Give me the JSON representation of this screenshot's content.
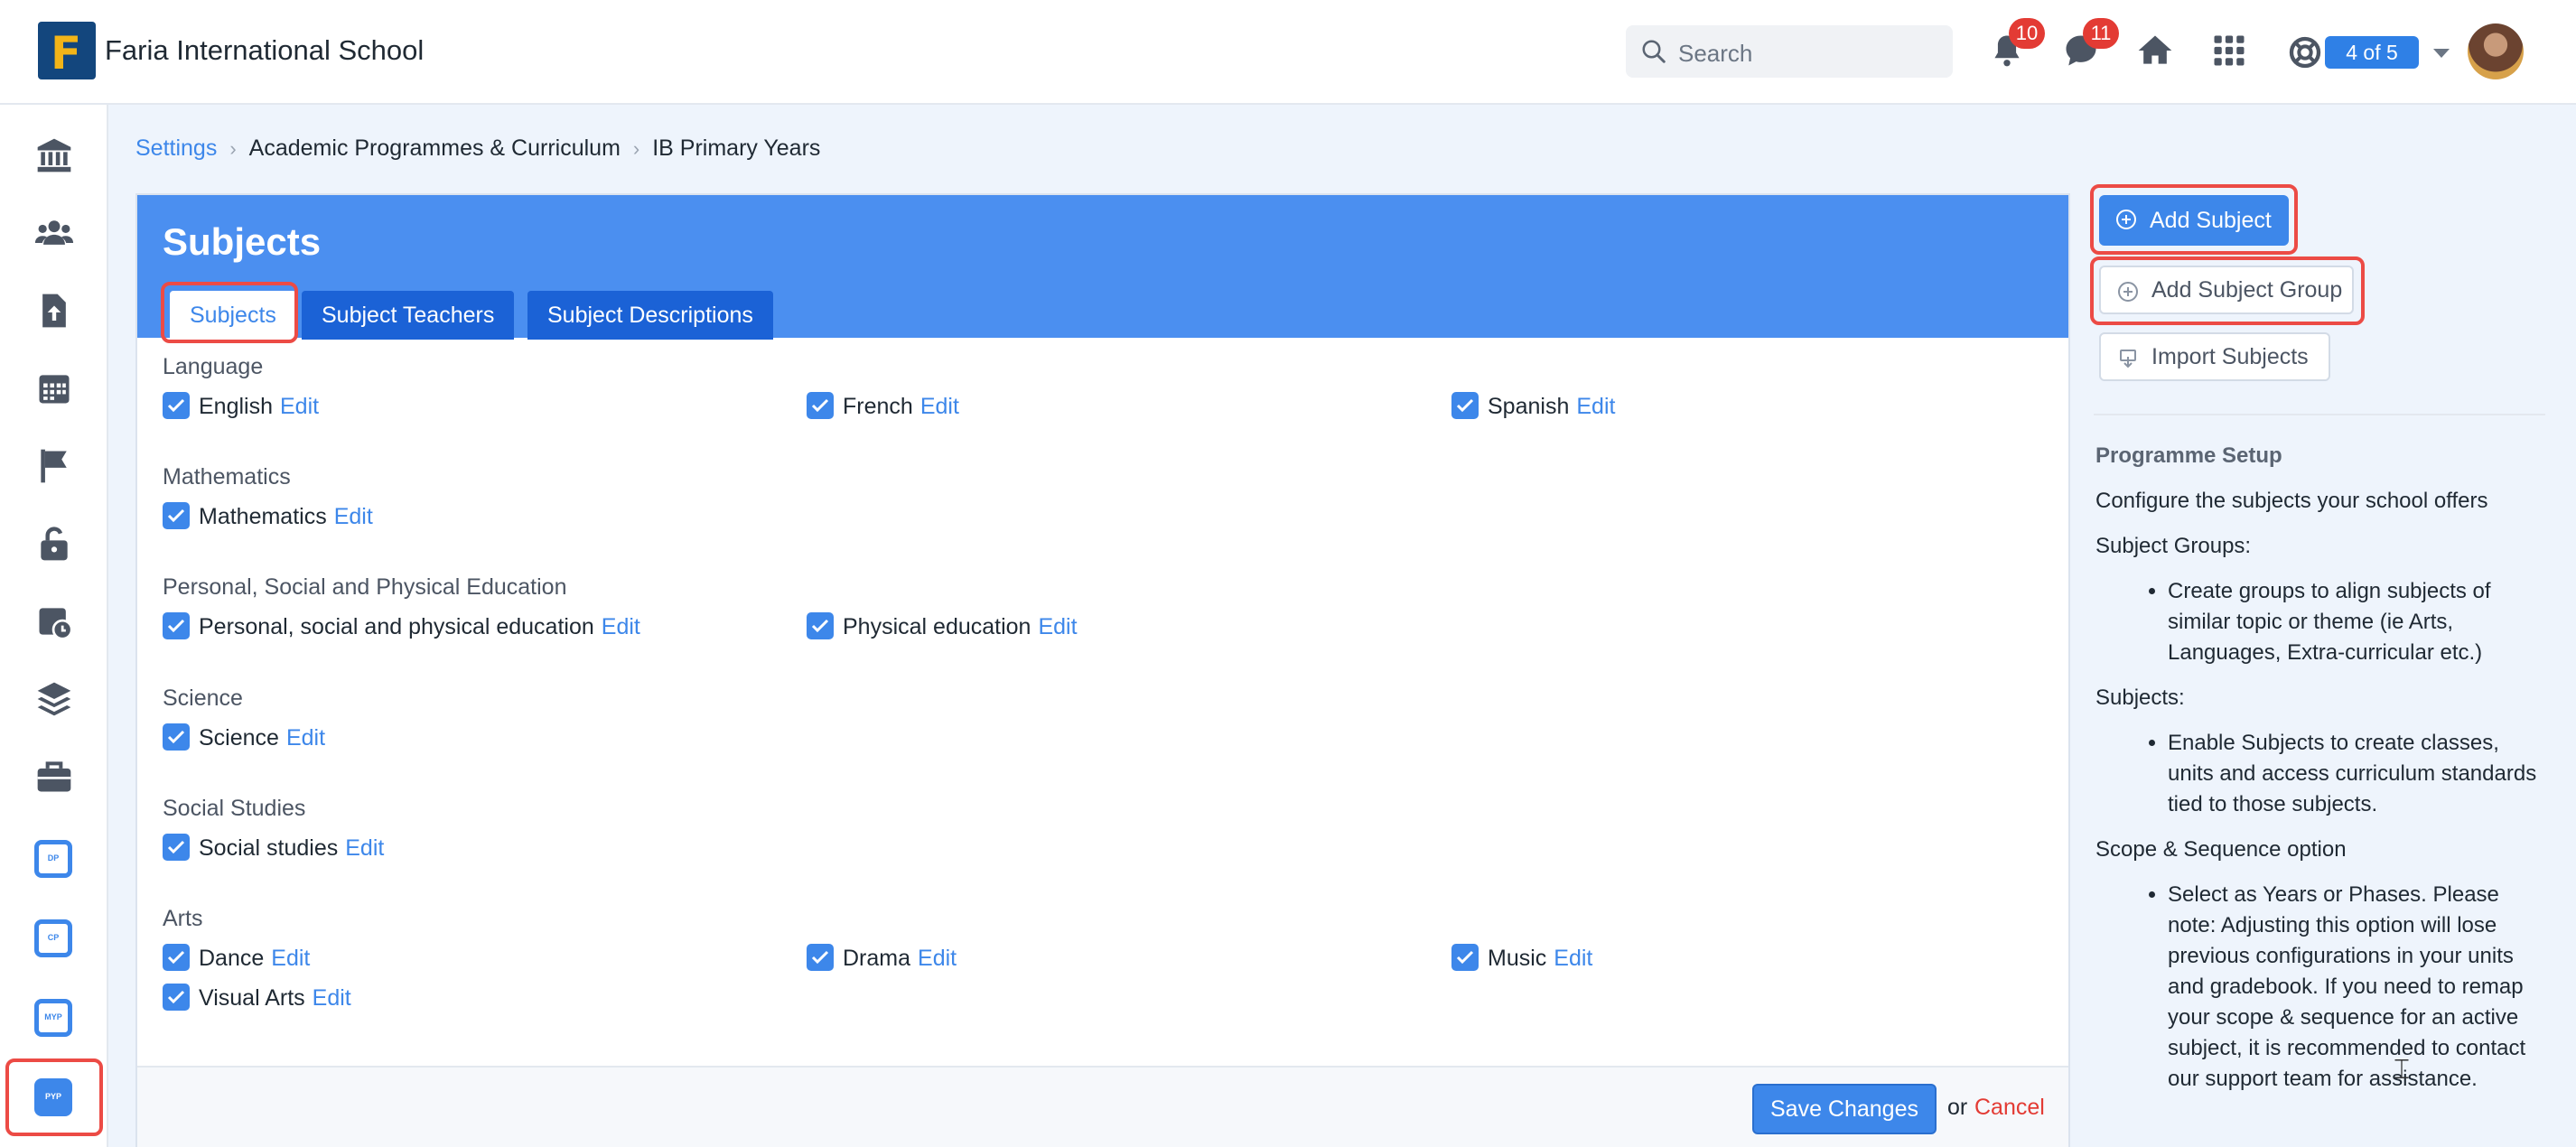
{
  "header": {
    "school_name": "Faria International School",
    "logo_letter": "F",
    "search_placeholder": "Search",
    "notifications_count": "10",
    "messages_count": "11",
    "help_pill": "4 of 5"
  },
  "breadcrumb": {
    "items": [
      "Settings",
      "Academic Programmes & Curriculum",
      "IB Primary Years"
    ]
  },
  "panel": {
    "title": "Subjects",
    "tabs": [
      "Subjects",
      "Subject Teachers",
      "Subject Descriptions"
    ],
    "edit_label": "Edit",
    "groups": [
      {
        "label": "Language",
        "subjects": [
          "English",
          "French",
          "Spanish"
        ]
      },
      {
        "label": "Mathematics",
        "subjects": [
          "Mathematics"
        ]
      },
      {
        "label": "Personal, Social and Physical Education",
        "subjects": [
          "Personal, social and physical education",
          "Physical education"
        ]
      },
      {
        "label": "Science",
        "subjects": [
          "Science"
        ]
      },
      {
        "label": "Social Studies",
        "subjects": [
          "Social studies"
        ]
      },
      {
        "label": "Arts",
        "subjects": [
          "Dance",
          "Drama",
          "Music",
          "Visual Arts"
        ]
      }
    ],
    "save_label": "Save Changes",
    "or_label": "or",
    "cancel_label": "Cancel"
  },
  "sidebar": {
    "programmes": [
      "DP",
      "CP",
      "MYP",
      "PYP"
    ]
  },
  "actions": {
    "add_subject": "Add Subject",
    "add_subject_group": "Add Subject Group",
    "import_subjects": "Import Subjects"
  },
  "setup": {
    "heading": "Programme Setup",
    "intro": "Configure the subjects your school offers",
    "groups_title": "Subject Groups:",
    "groups_bullet": "Create groups to align subjects of similar topic or theme (ie Arts, Languages, Extra-curricular etc.)",
    "subjects_title": "Subjects:",
    "subjects_bullet": "Enable Subjects to create classes, units and access curriculum standards tied to those subjects.",
    "scope_title": "Scope & Sequence option",
    "scope_bullet": "Select as Years or Phases. Please note: Adjusting this option will lose previous configurations in your units and gradebook. If you need to remap your scope & sequence for an active subject, it is recommended to contact our support team for assistance."
  },
  "colors": {
    "accent": "#3d87ea",
    "header_blue": "#4b8ff0",
    "tab_dark": "#1b62d6",
    "highlight": "#ec4b45",
    "badge": "#e33b34"
  }
}
